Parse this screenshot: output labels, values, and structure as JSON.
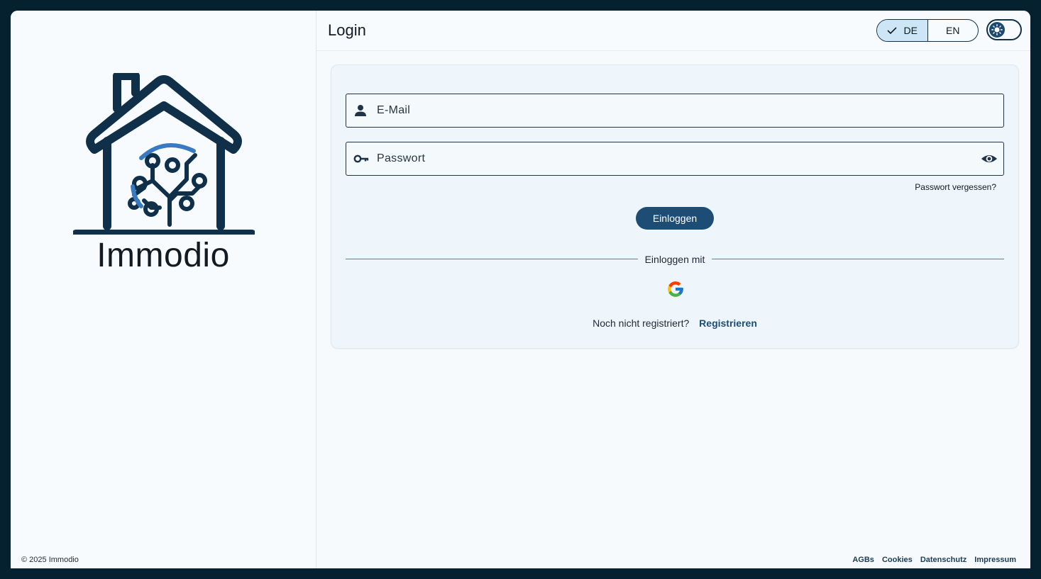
{
  "brand": {
    "name": "Immodio",
    "copyright": "© 2025 Immodio"
  },
  "header": {
    "title": "Login"
  },
  "language": {
    "options": [
      "DE",
      "EN"
    ],
    "selected": "DE"
  },
  "theme": {
    "icon": "sun-icon"
  },
  "form": {
    "email_placeholder": "E-Mail",
    "password_placeholder": "Passwort",
    "forgot_password": "Passwort vergessen?",
    "login_button": "Einloggen",
    "divider_label": "Einloggen mit",
    "register_question": "Noch nicht registriert?",
    "register_link": "Registrieren"
  },
  "footer": {
    "links": [
      "AGBs",
      "Cookies",
      "Datenschutz",
      "Impressum"
    ]
  },
  "colors": {
    "accent": "#1d4d74",
    "logo": "#0f3048",
    "frame": "#05202f"
  }
}
